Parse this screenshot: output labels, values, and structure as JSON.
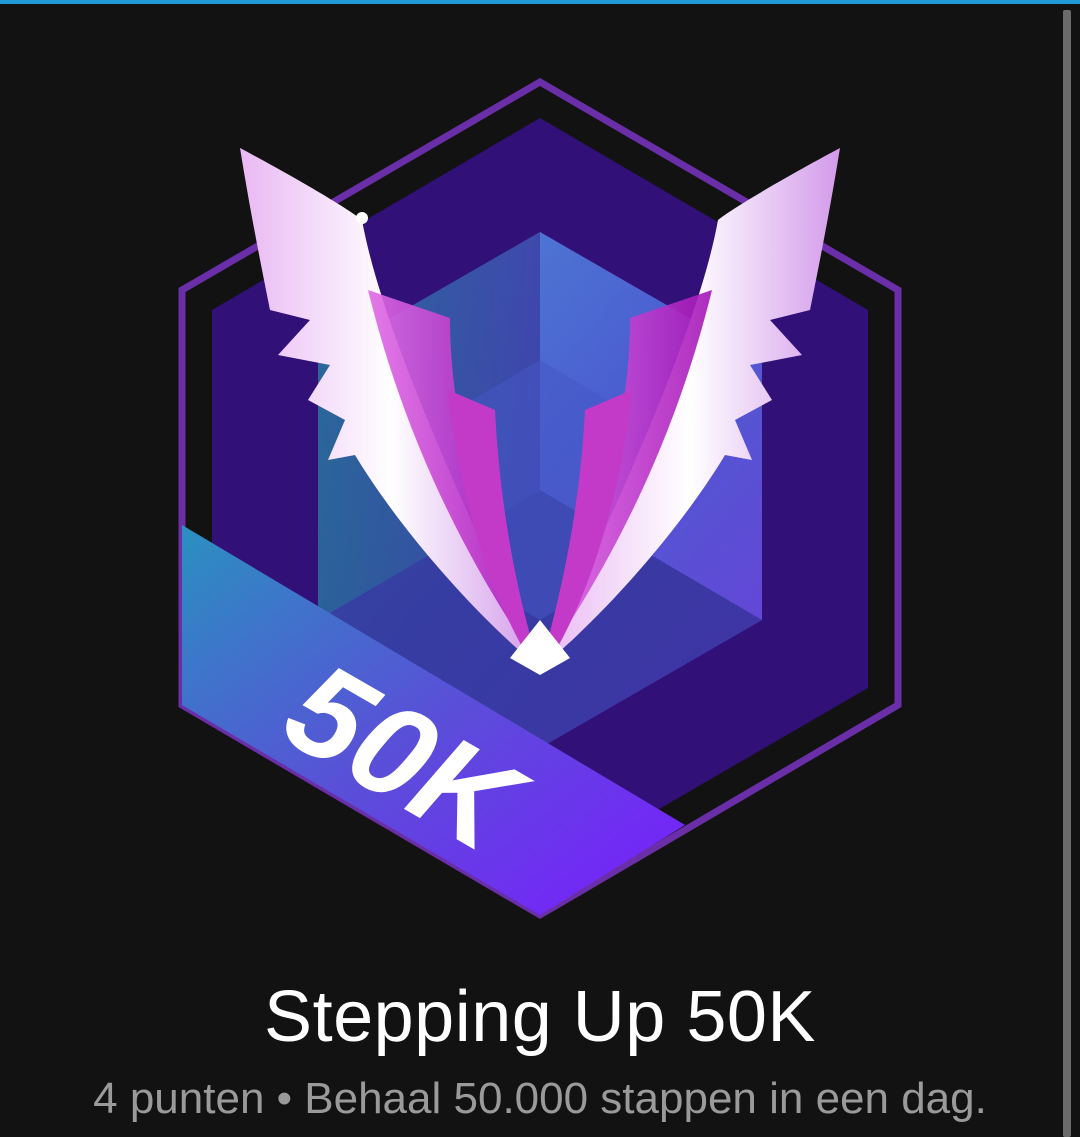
{
  "colors": {
    "background": "#121212",
    "top_accent": "#1e9bd7",
    "badge_purple_dark": "#311078",
    "badge_outline": "#6a2fa8",
    "ribbon_start": "#2a8fc0",
    "ribbon_end": "#7a1cff",
    "wing_white": "#f4e6ff",
    "wing_magenta": "#c02cc8",
    "title_text": "#ffffff",
    "description_text": "#9a9a9a"
  },
  "badge": {
    "icon": "winged-hexagon-badge-icon",
    "ribbon_label": "50K"
  },
  "title": "Stepping Up 50K",
  "description": "4 punten • Behaal 50.000 stappen in een dag."
}
